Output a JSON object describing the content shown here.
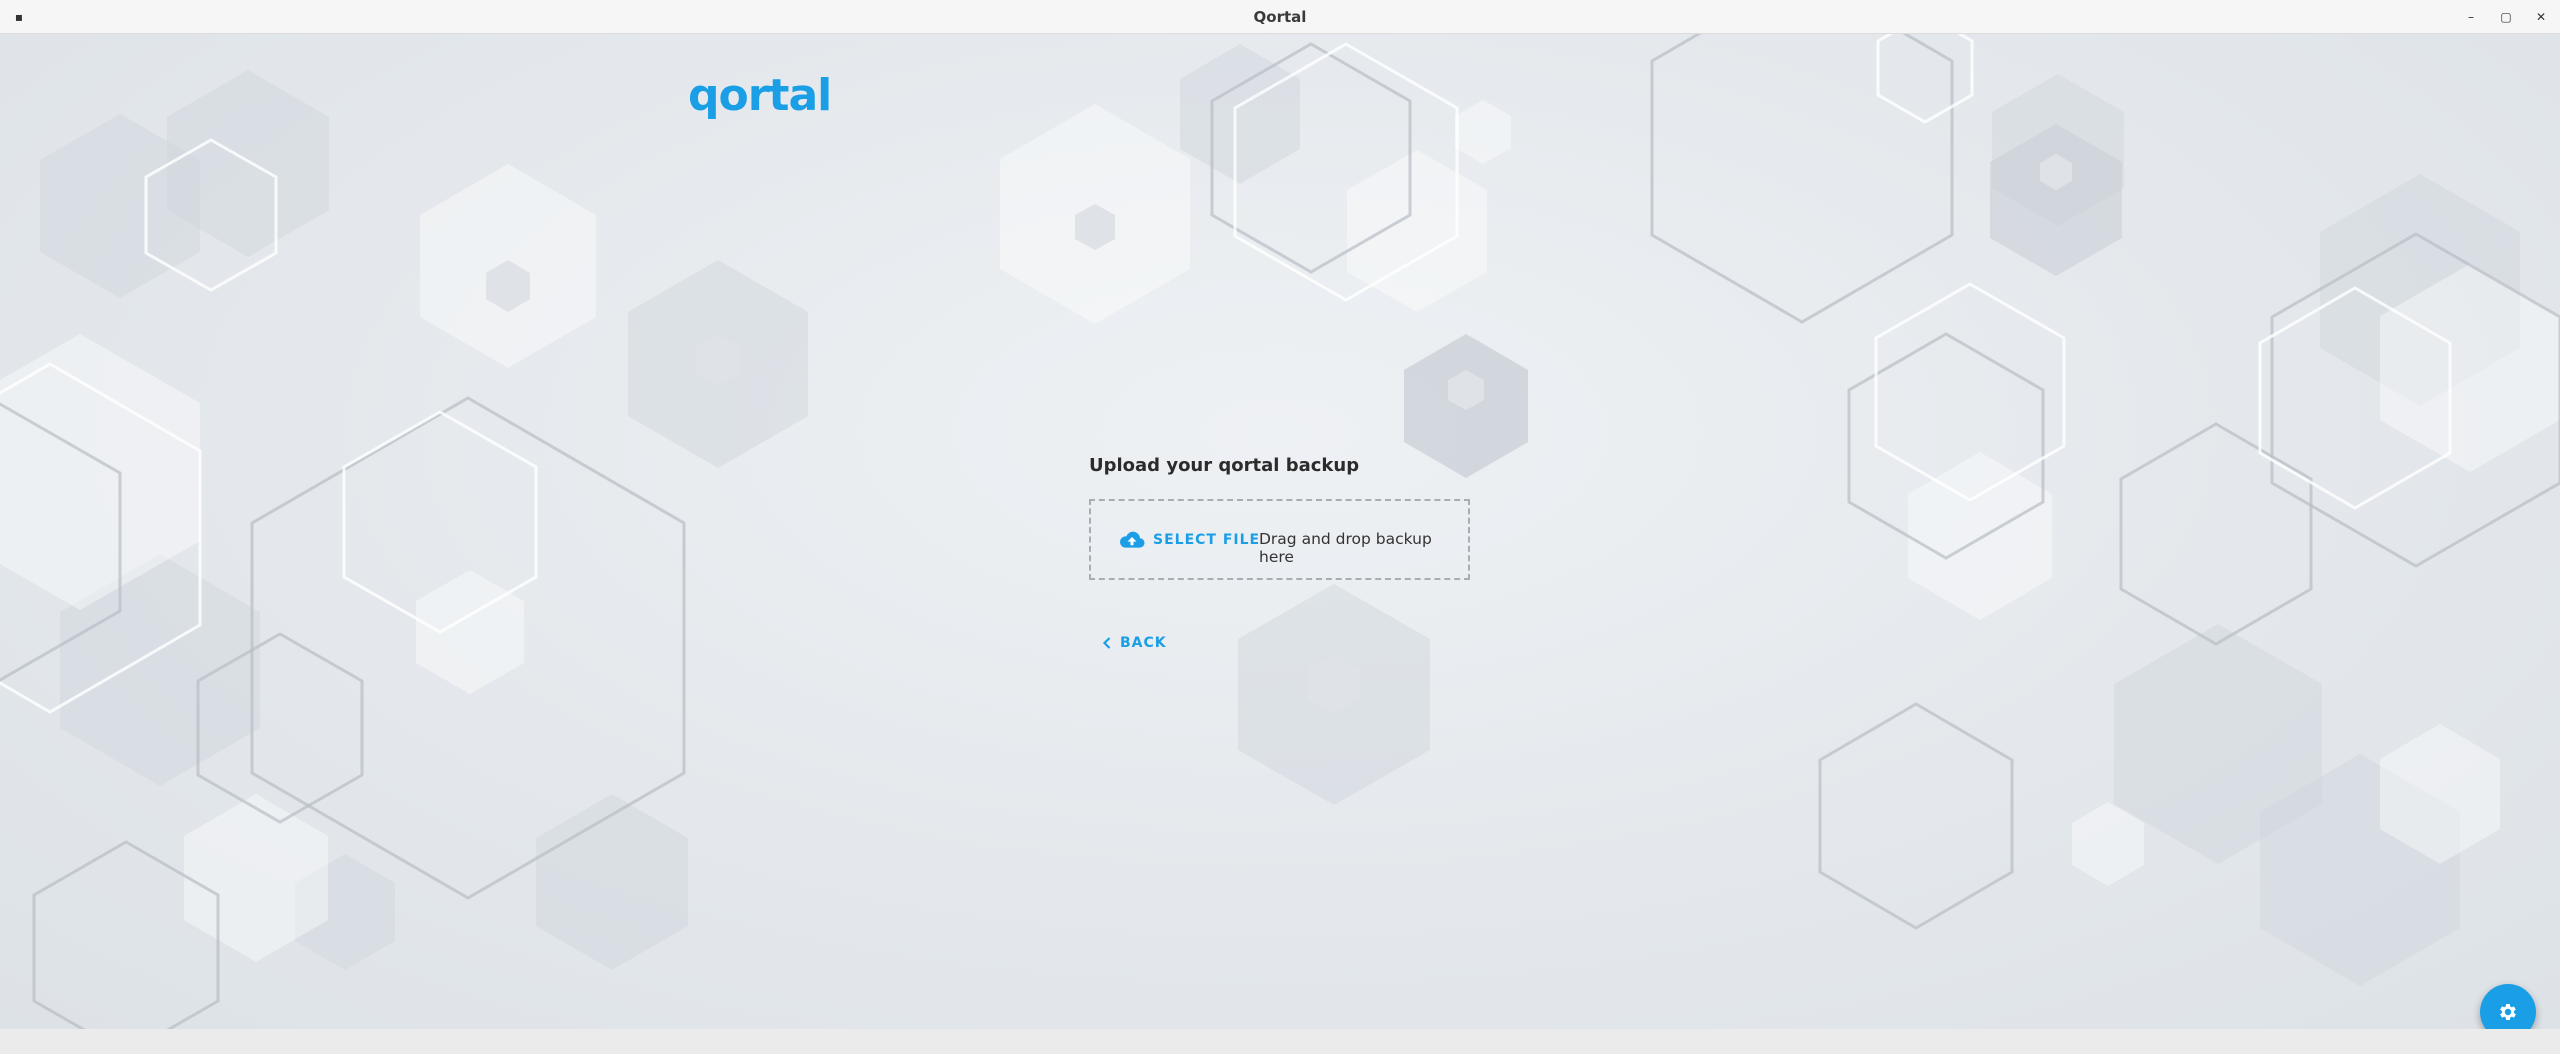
{
  "window": {
    "title": "Qortal",
    "menu_glyph": "▪",
    "minimize_glyph": "–",
    "maximize_glyph": "▢",
    "close_glyph": "✕"
  },
  "brand": {
    "logo_text": "qortal",
    "accent_color": "#1a9ee6"
  },
  "upload": {
    "title": "Upload your qortal backup",
    "select_file_label": "SELECT FILE",
    "select_file_icon": "cloud-upload-icon",
    "drop_hint": "Drag and drop backup here",
    "back_label": "BACK",
    "back_icon": "chevron-left-icon"
  },
  "fab": {
    "icon": "gear-icon"
  }
}
